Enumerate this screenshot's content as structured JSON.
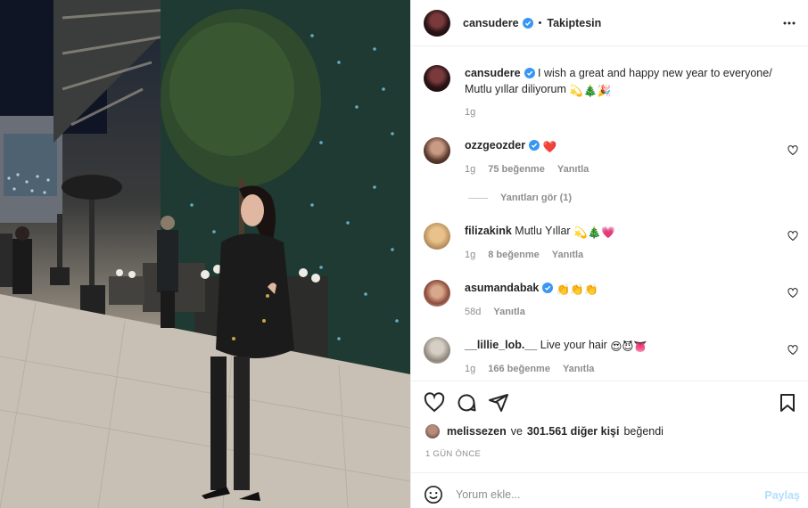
{
  "header": {
    "username": "cansudere",
    "follow_label": "Takiptesin",
    "more_icon": "more-horizontal-icon"
  },
  "caption": {
    "username": "cansudere",
    "text": "I wish a great and happy new year to everyone/ Mutlu yıllar diliyorum",
    "emojis": "💫🎄🎉",
    "time": "1g"
  },
  "comments": [
    {
      "username": "ozzgeozder",
      "verified": true,
      "text": "",
      "emojis": "❤️",
      "time": "1g",
      "likes": "75 beğenme",
      "reply_label": "Yanıtla"
    },
    {
      "username": "filizakink",
      "verified": false,
      "text": "Mutlu Yıllar",
      "emojis": "💫🎄💗",
      "time": "1g",
      "likes": "8 beğenme",
      "reply_label": "Yanıtla"
    },
    {
      "username": "asumandabak",
      "verified": true,
      "text": "",
      "emojis": "👏👏👏",
      "time": "58d",
      "likes": "",
      "reply_label": "Yanıtla"
    },
    {
      "username": "__lillie_lob.__",
      "verified": false,
      "text": "Live your hair",
      "emojis": "😍😈👅",
      "time": "1g",
      "likes": "166 beğenme",
      "reply_label": "Yanıtla"
    }
  ],
  "view_replies": "Yanıtları gör (1)",
  "actions": {
    "like_icon": "heart-icon",
    "comment_icon": "comment-icon",
    "share_icon": "send-icon",
    "save_icon": "bookmark-icon"
  },
  "likes_line": {
    "liker": "melissezen",
    "conjunction": "ve",
    "others": "301.561 diğer kişi",
    "suffix": "beğendi"
  },
  "date": "1 GÜN ÖNCE",
  "add_comment": {
    "placeholder": "Yorum ekle...",
    "post_label": "Paylaş"
  },
  "colors": {
    "verified": "#3897f0",
    "heart_red": "#ed4956",
    "post_button": "#b2dffc",
    "meta_gray": "#8e8e8e"
  }
}
